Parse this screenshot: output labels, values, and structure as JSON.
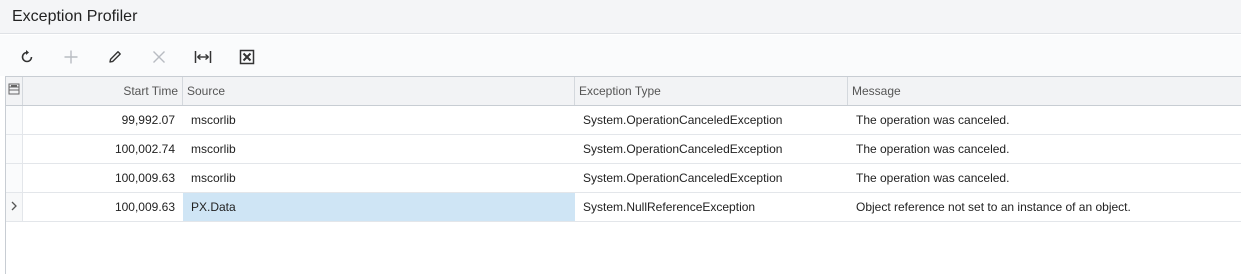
{
  "page": {
    "title": "Exception Profiler"
  },
  "toolbar": {
    "buttons": [
      {
        "name": "refresh-button",
        "icon": "refresh-icon",
        "enabled": true
      },
      {
        "name": "add-button",
        "icon": "plus-icon",
        "enabled": false
      },
      {
        "name": "edit-button",
        "icon": "pencil-icon",
        "enabled": true
      },
      {
        "name": "delete-button",
        "icon": "close-icon",
        "enabled": false
      },
      {
        "name": "fit-columns-button",
        "icon": "fit-width-icon",
        "enabled": true
      },
      {
        "name": "export-excel-button",
        "icon": "excel-icon",
        "enabled": true
      }
    ]
  },
  "grid": {
    "selector_icon": "grid-settings-icon",
    "columns": [
      "Start Time",
      "Source",
      "Exception Type",
      "Message"
    ],
    "rows": [
      {
        "start_time": "99,992.07",
        "source": "mscorlib",
        "exception_type": "System.OperationCanceledException",
        "message": "The operation was canceled."
      },
      {
        "start_time": "100,002.74",
        "source": "mscorlib",
        "exception_type": "System.OperationCanceledException",
        "message": "The operation was canceled."
      },
      {
        "start_time": "100,009.63",
        "source": "mscorlib",
        "exception_type": "System.OperationCanceledException",
        "message": "The operation was canceled."
      },
      {
        "start_time": "100,009.63",
        "source": "PX.Data",
        "exception_type": "System.NullReferenceException",
        "message": "Object reference not set to an instance of an object."
      }
    ],
    "active_row_index": 3
  },
  "colors": {
    "accent_selection": "#cfe5f5",
    "icon": "#333333",
    "icon_disabled": "#b8bcc2"
  }
}
